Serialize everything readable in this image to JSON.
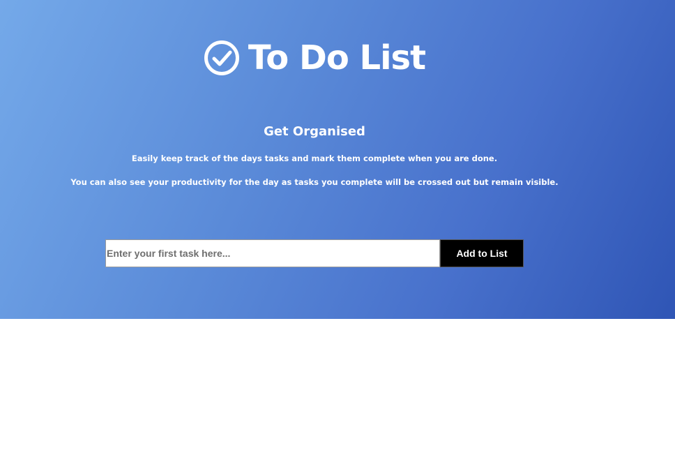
{
  "header": {
    "icon": "check-circle-icon",
    "title": "To Do List"
  },
  "intro": {
    "heading": "Get Organised",
    "line1": "Easily keep track of the days tasks and mark them complete when you are done.",
    "line2": "You can also see your productivity for the day as tasks you complete will be crossed out but remain visible."
  },
  "form": {
    "placeholder": "Enter your first task here...",
    "value": "",
    "button_label": "Add to List"
  },
  "colors": {
    "gradient_start": "#74a9e9",
    "gradient_end": "#2f55b5",
    "button_bg": "#000000",
    "text": "#ffffff"
  },
  "tasks": []
}
